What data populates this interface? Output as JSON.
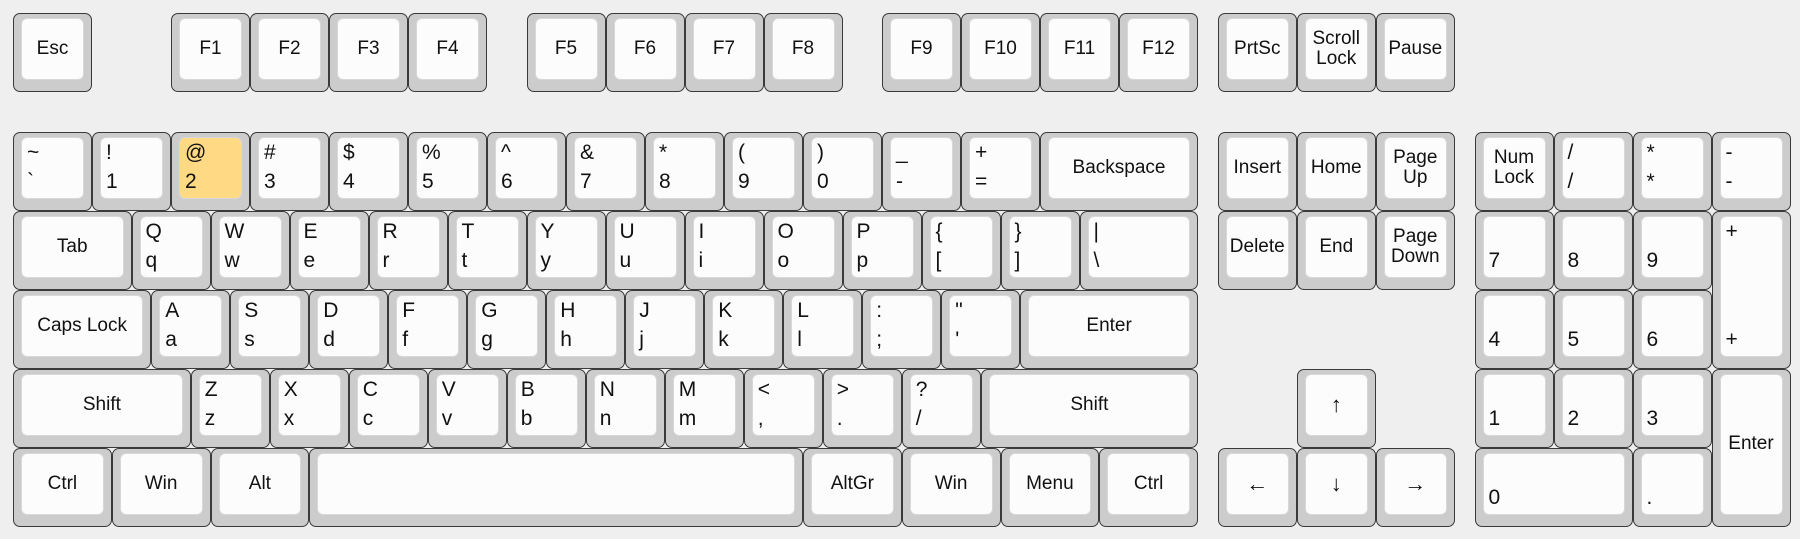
{
  "highlight": {
    "key": "2",
    "color": "#ffd983"
  },
  "colors": {
    "background": "#efefef",
    "key_base": "#cccccc",
    "key_cap": "#fcfcfc",
    "border": "#3a3a3a"
  },
  "keys": [
    {
      "label": "Esc"
    },
    {
      "label": "F1"
    },
    {
      "label": "F2"
    },
    {
      "label": "F3"
    },
    {
      "label": "F4"
    },
    {
      "label": "F5"
    },
    {
      "label": "F6"
    },
    {
      "label": "F7"
    },
    {
      "label": "F8"
    },
    {
      "label": "F9"
    },
    {
      "label": "F10"
    },
    {
      "label": "F11"
    },
    {
      "label": "F12"
    },
    {
      "label": "PrtSc"
    },
    {
      "label": "Scroll\nLock"
    },
    {
      "label": "Pause"
    },
    {
      "top": "~",
      "bottom": "`"
    },
    {
      "top": "!",
      "bottom": "1"
    },
    {
      "top": "@",
      "bottom": "2"
    },
    {
      "top": "#",
      "bottom": "3"
    },
    {
      "top": "$",
      "bottom": "4"
    },
    {
      "top": "%",
      "bottom": "5"
    },
    {
      "top": "^",
      "bottom": "6"
    },
    {
      "top": "&",
      "bottom": "7"
    },
    {
      "top": "*",
      "bottom": "8"
    },
    {
      "top": "(",
      "bottom": "9"
    },
    {
      "top": ")",
      "bottom": "0"
    },
    {
      "top": "_",
      "bottom": "-"
    },
    {
      "top": "+",
      "bottom": "="
    },
    {
      "label": "Backspace"
    },
    {
      "label": "Insert"
    },
    {
      "label": "Home"
    },
    {
      "label": "Page\nUp"
    },
    {
      "label": "Num\nLock"
    },
    {
      "top": "/",
      "bottom": "/"
    },
    {
      "top": "*",
      "bottom": "*"
    },
    {
      "top": "-",
      "bottom": "-"
    },
    {
      "label": "Tab"
    },
    {
      "top": "Q",
      "bottom": "q"
    },
    {
      "top": "W",
      "bottom": "w"
    },
    {
      "top": "E",
      "bottom": "e"
    },
    {
      "top": "R",
      "bottom": "r"
    },
    {
      "top": "T",
      "bottom": "t"
    },
    {
      "top": "Y",
      "bottom": "y"
    },
    {
      "top": "U",
      "bottom": "u"
    },
    {
      "top": "I",
      "bottom": "i"
    },
    {
      "top": "O",
      "bottom": "o"
    },
    {
      "top": "P",
      "bottom": "p"
    },
    {
      "top": "{",
      "bottom": "["
    },
    {
      "top": "}",
      "bottom": "]"
    },
    {
      "top": "|",
      "bottom": "\\"
    },
    {
      "label": "Delete"
    },
    {
      "label": "End"
    },
    {
      "label": "Page\nDown"
    },
    {
      "bottom": "7"
    },
    {
      "bottom": "8"
    },
    {
      "bottom": "9"
    },
    {
      "top": "+",
      "bottom": "+"
    },
    {
      "label": "Caps Lock"
    },
    {
      "top": "A",
      "bottom": "a"
    },
    {
      "top": "S",
      "bottom": "s"
    },
    {
      "top": "D",
      "bottom": "d"
    },
    {
      "top": "F",
      "bottom": "f"
    },
    {
      "top": "G",
      "bottom": "g"
    },
    {
      "top": "H",
      "bottom": "h"
    },
    {
      "top": "J",
      "bottom": "j"
    },
    {
      "top": "K",
      "bottom": "k"
    },
    {
      "top": "L",
      "bottom": "l"
    },
    {
      "top": ":",
      "bottom": ";"
    },
    {
      "top": "\"",
      "bottom": "'"
    },
    {
      "label": "Enter"
    },
    {
      "bottom": "4"
    },
    {
      "bottom": "5"
    },
    {
      "bottom": "6"
    },
    {
      "label": "Shift"
    },
    {
      "top": "Z",
      "bottom": "z"
    },
    {
      "top": "X",
      "bottom": "x"
    },
    {
      "top": "C",
      "bottom": "c"
    },
    {
      "top": "V",
      "bottom": "v"
    },
    {
      "top": "B",
      "bottom": "b"
    },
    {
      "top": "N",
      "bottom": "n"
    },
    {
      "top": "M",
      "bottom": "m"
    },
    {
      "top": "<",
      "bottom": ","
    },
    {
      "top": ">",
      "bottom": "."
    },
    {
      "top": "?",
      "bottom": "/"
    },
    {
      "label": "Shift"
    },
    {
      "label": "↑"
    },
    {
      "bottom": "1"
    },
    {
      "bottom": "2"
    },
    {
      "bottom": "3"
    },
    {
      "label": "Enter"
    },
    {
      "label": "Ctrl"
    },
    {
      "label": "Win"
    },
    {
      "label": "Alt"
    },
    {
      "label": ""
    },
    {
      "label": "AltGr"
    },
    {
      "label": "Win"
    },
    {
      "label": "Menu"
    },
    {
      "label": "Ctrl"
    },
    {
      "label": "←"
    },
    {
      "label": "↓"
    },
    {
      "label": "→"
    },
    {
      "bottom": "0"
    },
    {
      "bottom": "."
    }
  ]
}
